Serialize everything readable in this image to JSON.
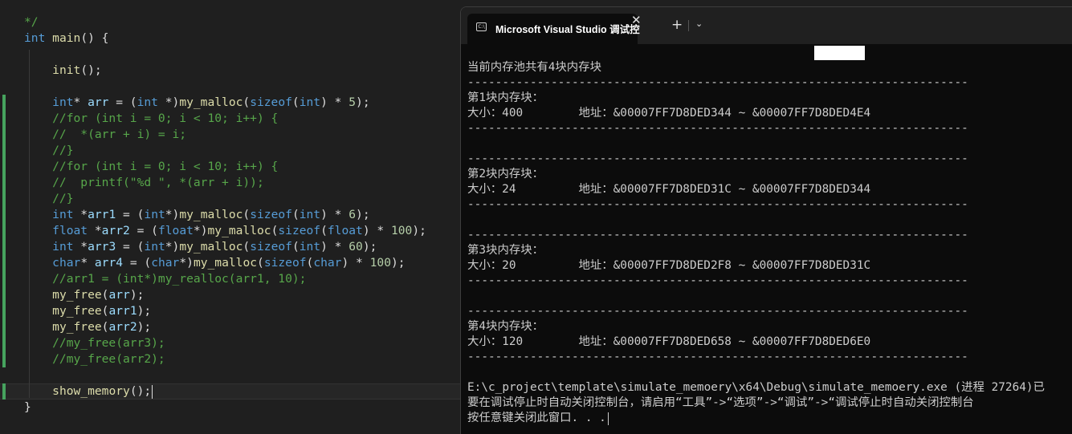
{
  "editor": {
    "lines": [
      [
        {
          "t": "*/",
          "c": "cm"
        }
      ],
      [
        {
          "t": "int",
          "c": "kw"
        },
        {
          "t": " ",
          "c": "pl"
        },
        {
          "t": "main",
          "c": "fn"
        },
        {
          "t": "() {",
          "c": "pl"
        }
      ],
      [],
      [
        {
          "t": "    ",
          "c": "pl"
        },
        {
          "t": "init",
          "c": "fn"
        },
        {
          "t": "();",
          "c": "pl"
        }
      ],
      [],
      [
        {
          "t": "    ",
          "c": "pl"
        },
        {
          "t": "int",
          "c": "kw"
        },
        {
          "t": "* ",
          "c": "pl"
        },
        {
          "t": "arr",
          "c": "vr"
        },
        {
          "t": " = (",
          "c": "pl"
        },
        {
          "t": "int",
          "c": "kw"
        },
        {
          "t": " *)",
          "c": "pl"
        },
        {
          "t": "my_malloc",
          "c": "fn"
        },
        {
          "t": "(",
          "c": "pl"
        },
        {
          "t": "sizeof",
          "c": "kw"
        },
        {
          "t": "(",
          "c": "pl"
        },
        {
          "t": "int",
          "c": "kw"
        },
        {
          "t": ") * ",
          "c": "pl"
        },
        {
          "t": "5",
          "c": "num"
        },
        {
          "t": ");",
          "c": "pl"
        }
      ],
      [
        {
          "t": "    //for (int i = 0; i < 10; i++) {",
          "c": "cm"
        }
      ],
      [
        {
          "t": "    //  *(arr + i) = i;",
          "c": "cm"
        }
      ],
      [
        {
          "t": "    //}",
          "c": "cm"
        }
      ],
      [
        {
          "t": "    //for (int i = 0; i < 10; i++) {",
          "c": "cm"
        }
      ],
      [
        {
          "t": "    //  printf(\"%d \", *(arr + i));",
          "c": "cm"
        }
      ],
      [
        {
          "t": "    //}",
          "c": "cm"
        }
      ],
      [
        {
          "t": "    ",
          "c": "pl"
        },
        {
          "t": "int",
          "c": "kw"
        },
        {
          "t": " *",
          "c": "pl"
        },
        {
          "t": "arr1",
          "c": "vr"
        },
        {
          "t": " = (",
          "c": "pl"
        },
        {
          "t": "int",
          "c": "kw"
        },
        {
          "t": "*)",
          "c": "pl"
        },
        {
          "t": "my_malloc",
          "c": "fn"
        },
        {
          "t": "(",
          "c": "pl"
        },
        {
          "t": "sizeof",
          "c": "kw"
        },
        {
          "t": "(",
          "c": "pl"
        },
        {
          "t": "int",
          "c": "kw"
        },
        {
          "t": ") * ",
          "c": "pl"
        },
        {
          "t": "6",
          "c": "num"
        },
        {
          "t": ");",
          "c": "pl"
        }
      ],
      [
        {
          "t": "    ",
          "c": "pl"
        },
        {
          "t": "float",
          "c": "kw"
        },
        {
          "t": " *",
          "c": "pl"
        },
        {
          "t": "arr2",
          "c": "vr"
        },
        {
          "t": " = (",
          "c": "pl"
        },
        {
          "t": "float",
          "c": "kw"
        },
        {
          "t": "*)",
          "c": "pl"
        },
        {
          "t": "my_malloc",
          "c": "fn"
        },
        {
          "t": "(",
          "c": "pl"
        },
        {
          "t": "sizeof",
          "c": "kw"
        },
        {
          "t": "(",
          "c": "pl"
        },
        {
          "t": "float",
          "c": "kw"
        },
        {
          "t": ") * ",
          "c": "pl"
        },
        {
          "t": "100",
          "c": "num"
        },
        {
          "t": ");",
          "c": "pl"
        }
      ],
      [
        {
          "t": "    ",
          "c": "pl"
        },
        {
          "t": "int",
          "c": "kw"
        },
        {
          "t": " *",
          "c": "pl"
        },
        {
          "t": "arr3",
          "c": "vr"
        },
        {
          "t": " = (",
          "c": "pl"
        },
        {
          "t": "int",
          "c": "kw"
        },
        {
          "t": "*)",
          "c": "pl"
        },
        {
          "t": "my_malloc",
          "c": "fn"
        },
        {
          "t": "(",
          "c": "pl"
        },
        {
          "t": "sizeof",
          "c": "kw"
        },
        {
          "t": "(",
          "c": "pl"
        },
        {
          "t": "int",
          "c": "kw"
        },
        {
          "t": ") * ",
          "c": "pl"
        },
        {
          "t": "60",
          "c": "num"
        },
        {
          "t": ");",
          "c": "pl"
        }
      ],
      [
        {
          "t": "    ",
          "c": "pl"
        },
        {
          "t": "char",
          "c": "kw"
        },
        {
          "t": "* ",
          "c": "pl"
        },
        {
          "t": "arr4",
          "c": "vr"
        },
        {
          "t": " = (",
          "c": "pl"
        },
        {
          "t": "char",
          "c": "kw"
        },
        {
          "t": "*)",
          "c": "pl"
        },
        {
          "t": "my_malloc",
          "c": "fn"
        },
        {
          "t": "(",
          "c": "pl"
        },
        {
          "t": "sizeof",
          "c": "kw"
        },
        {
          "t": "(",
          "c": "pl"
        },
        {
          "t": "char",
          "c": "kw"
        },
        {
          "t": ") * ",
          "c": "pl"
        },
        {
          "t": "100",
          "c": "num"
        },
        {
          "t": ");",
          "c": "pl"
        }
      ],
      [
        {
          "t": "    //arr1 = (int*)my_realloc(arr1, 10);",
          "c": "cm"
        }
      ],
      [
        {
          "t": "    ",
          "c": "pl"
        },
        {
          "t": "my_free",
          "c": "fn"
        },
        {
          "t": "(",
          "c": "pl"
        },
        {
          "t": "arr",
          "c": "vr"
        },
        {
          "t": ");",
          "c": "pl"
        }
      ],
      [
        {
          "t": "    ",
          "c": "pl"
        },
        {
          "t": "my_free",
          "c": "fn"
        },
        {
          "t": "(",
          "c": "pl"
        },
        {
          "t": "arr1",
          "c": "vr"
        },
        {
          "t": ");",
          "c": "pl"
        }
      ],
      [
        {
          "t": "    ",
          "c": "pl"
        },
        {
          "t": "my_free",
          "c": "fn"
        },
        {
          "t": "(",
          "c": "pl"
        },
        {
          "t": "arr2",
          "c": "vr"
        },
        {
          "t": ");",
          "c": "pl"
        }
      ],
      [
        {
          "t": "    //my_free(arr3);",
          "c": "cm"
        }
      ],
      [
        {
          "t": "    //my_free(arr2);",
          "c": "cm"
        }
      ],
      [],
      [
        {
          "t": "    ",
          "c": "pl"
        },
        {
          "t": "show_memory",
          "c": "fn"
        },
        {
          "t": "();",
          "c": "pl"
        }
      ],
      [
        {
          "t": "}",
          "c": "pl"
        }
      ]
    ],
    "colors": {
      "kw": "#569cd6",
      "fn": "#dcdcaa",
      "vr": "#9cdcfe",
      "num": "#b5cea8",
      "cm": "#57a64a",
      "pl": "#dcdcdc",
      "change": "#46a35e"
    }
  },
  "console": {
    "tab_icon": "console-app-icon",
    "tab_icon_glyph": "C:\\",
    "tab_title": "Microsoft Visual Studio 调试控",
    "close_glyph": "✕",
    "new_tab_glyph": "+",
    "dropdown_glyph": "⌄",
    "lines": [
      "当前内存池共有4块内存块",
      "------------------------------------------------------------------------",
      "第1块内存块：",
      "大小：400        地址：&00007FF7D8DED344 ~ &00007FF7D8DED4E4",
      "------------------------------------------------------------------------",
      "",
      "------------------------------------------------------------------------",
      "第2块内存块：",
      "大小：24         地址：&00007FF7D8DED31C ~ &00007FF7D8DED344",
      "------------------------------------------------------------------------",
      "",
      "------------------------------------------------------------------------",
      "第3块内存块：",
      "大小：20         地址：&00007FF7D8DED2F8 ~ &00007FF7D8DED31C",
      "------------------------------------------------------------------------",
      "",
      "------------------------------------------------------------------------",
      "第4块内存块：",
      "大小：120        地址：&00007FF7D8DED658 ~ &00007FF7D8DED6E0",
      "------------------------------------------------------------------------",
      "",
      "E:\\c_project\\template\\simulate_memoery\\x64\\Debug\\simulate_memoery.exe (进程 27264)已",
      "要在调试停止时自动关闭控制台，请启用“工具”->“选项”->“调试”->“调试停止时自动关闭控制台",
      "按任意键关闭此窗口. . ."
    ]
  }
}
